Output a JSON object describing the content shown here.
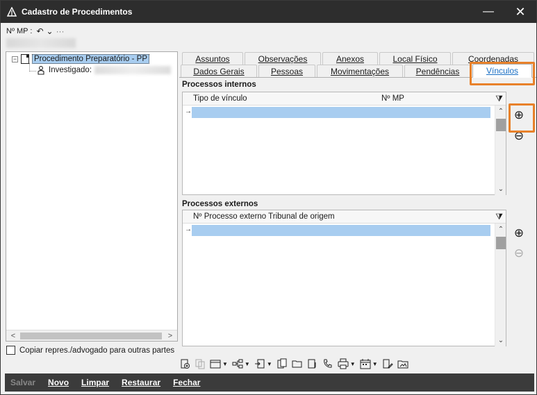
{
  "window": {
    "title": "Cadastro de Procedimentos",
    "minimize_glyph": "—",
    "close_glyph": "✕"
  },
  "mp_row": {
    "label": "Nº MP :",
    "undo_glyph": "↶",
    "chevron_glyph": "⌄",
    "more_glyph": "···"
  },
  "tree": {
    "root": {
      "expander": "−",
      "label": "Procedimento Preparatório - PP"
    },
    "child": {
      "label": "Investigado:"
    }
  },
  "scroll": {
    "left_glyph": "<",
    "right_glyph": ">",
    "up_glyph": "⌃",
    "down_glyph": "⌄"
  },
  "copy_checkbox": {
    "label": "Copiar repres./advogado para outras partes"
  },
  "tabs_row1": [
    "Assuntos",
    "Observações",
    "Anexos",
    "Local Físico",
    "Coordenadas"
  ],
  "tabs_row2": [
    "Dados Gerais",
    "Pessoas",
    "Movimentações",
    "Pendências",
    "Vínculos"
  ],
  "active_tab": "Vínculos",
  "internos": {
    "title": "Processos internos",
    "columns": [
      "Tipo de vínculo",
      "Nº MP"
    ],
    "row_marker": "→",
    "filter_glyph": "⧩"
  },
  "externos": {
    "title": "Processos externos",
    "columns": [
      "Nº Processo externo Tribunal de origem"
    ],
    "row_marker": "→",
    "filter_glyph": "⧩"
  },
  "side_buttons": {
    "add_glyph": "⊕",
    "remove_glyph": "⊖"
  },
  "bottom": {
    "salvar": "Salvar",
    "novo": "Novo",
    "limpar": "Limpar",
    "restaurar": "Restaurar",
    "fechar": "Fechar"
  },
  "colors": {
    "accent_orange": "#e8812a",
    "selection_blue": "#a8cdf0",
    "active_tab_text": "#1a6fc4",
    "titlebar": "#2d2d2d"
  }
}
